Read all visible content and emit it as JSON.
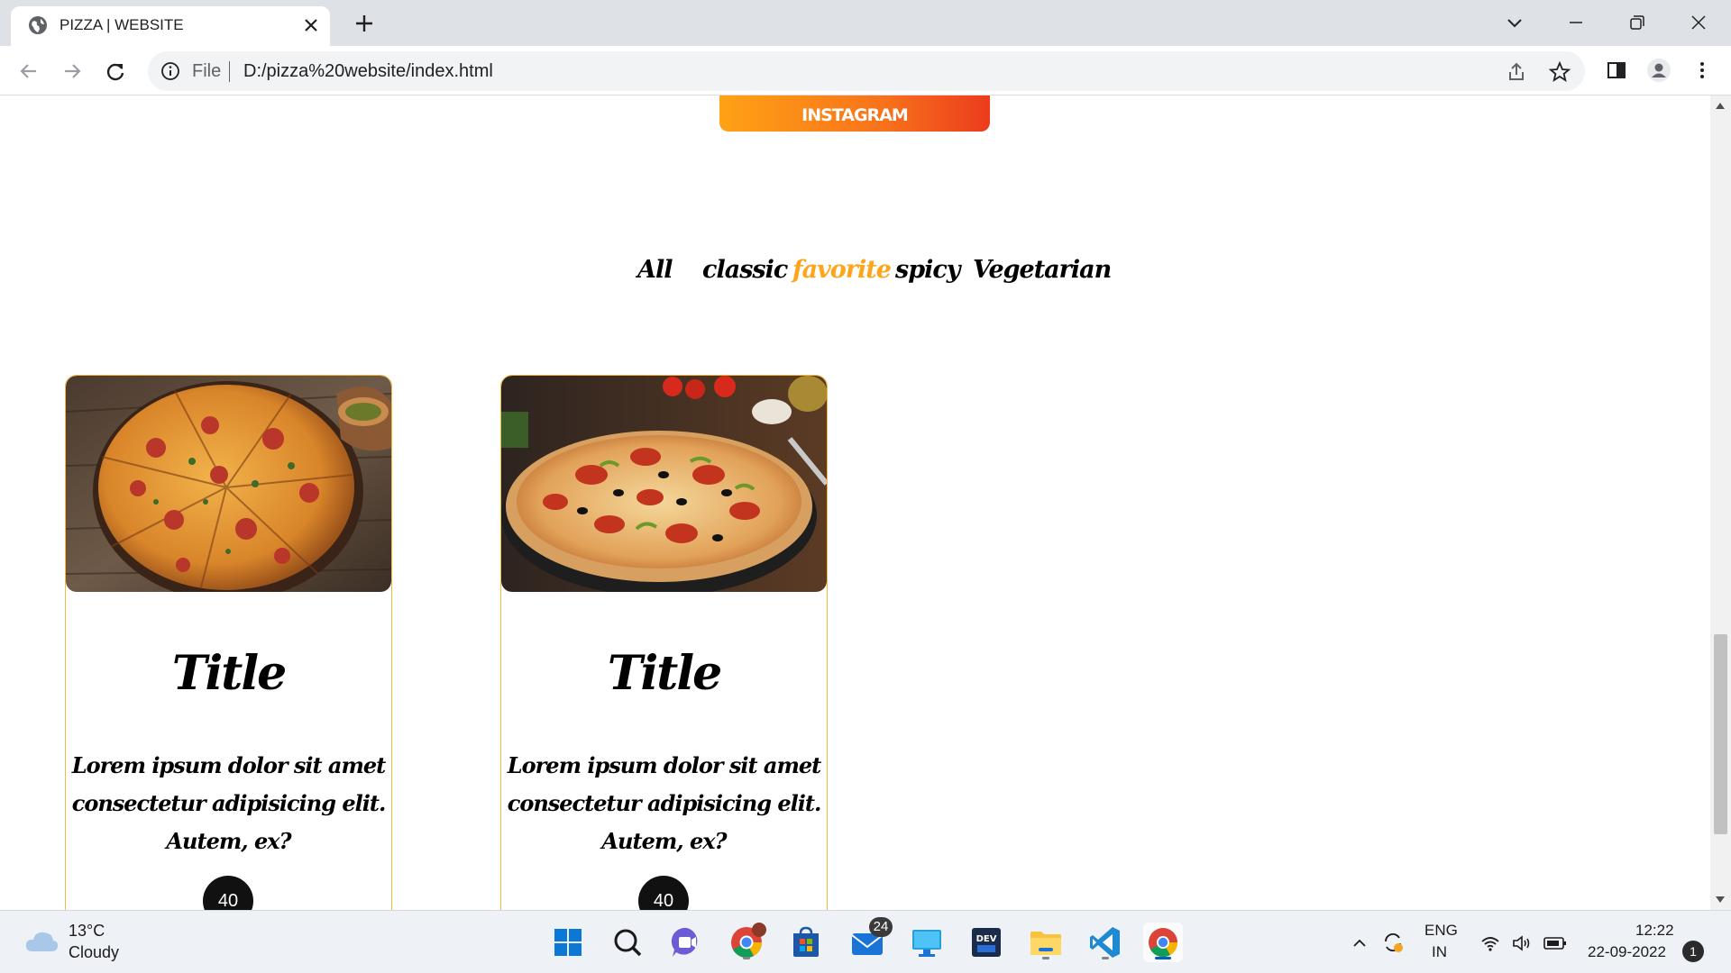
{
  "browser": {
    "tab_title": "PIZZA | WEBSITE",
    "omnibox_scheme": "File",
    "url": "D:/pizza%20website/index.html"
  },
  "page": {
    "instagram_label": "INSTAGRAM",
    "filters": [
      {
        "label": "All",
        "active": false
      },
      {
        "label": "classic",
        "active": false
      },
      {
        "label": "favorite",
        "active": true
      },
      {
        "label": "spicy",
        "active": false
      },
      {
        "label": "Vegetarian",
        "active": false
      }
    ],
    "accent_color": "#ffa51c",
    "cards": [
      {
        "title": "Title",
        "description": "Lorem ipsum dolor sit amet consectetur adipisicing elit. Autem, ex?",
        "price": "40"
      },
      {
        "title": "Title",
        "description": "Lorem ipsum dolor sit amet consectetur adipisicing elit. Autem, ex?",
        "price": "40"
      }
    ]
  },
  "taskbar": {
    "weather_temp": "13°C",
    "weather_condition": "Cloudy",
    "mail_badge": "24",
    "lang_top": "ENG",
    "lang_bottom": "IN",
    "time": "12:22",
    "date": "22-09-2022",
    "notification_count": "1",
    "apps": [
      "start-icon",
      "search-icon",
      "teams-chat-icon",
      "chrome-profile-icon",
      "microsoft-store-icon",
      "mail-icon",
      "remote-desktop-icon",
      "devhome-icon",
      "file-explorer-icon",
      "vscode-icon",
      "chrome-icon"
    ]
  }
}
